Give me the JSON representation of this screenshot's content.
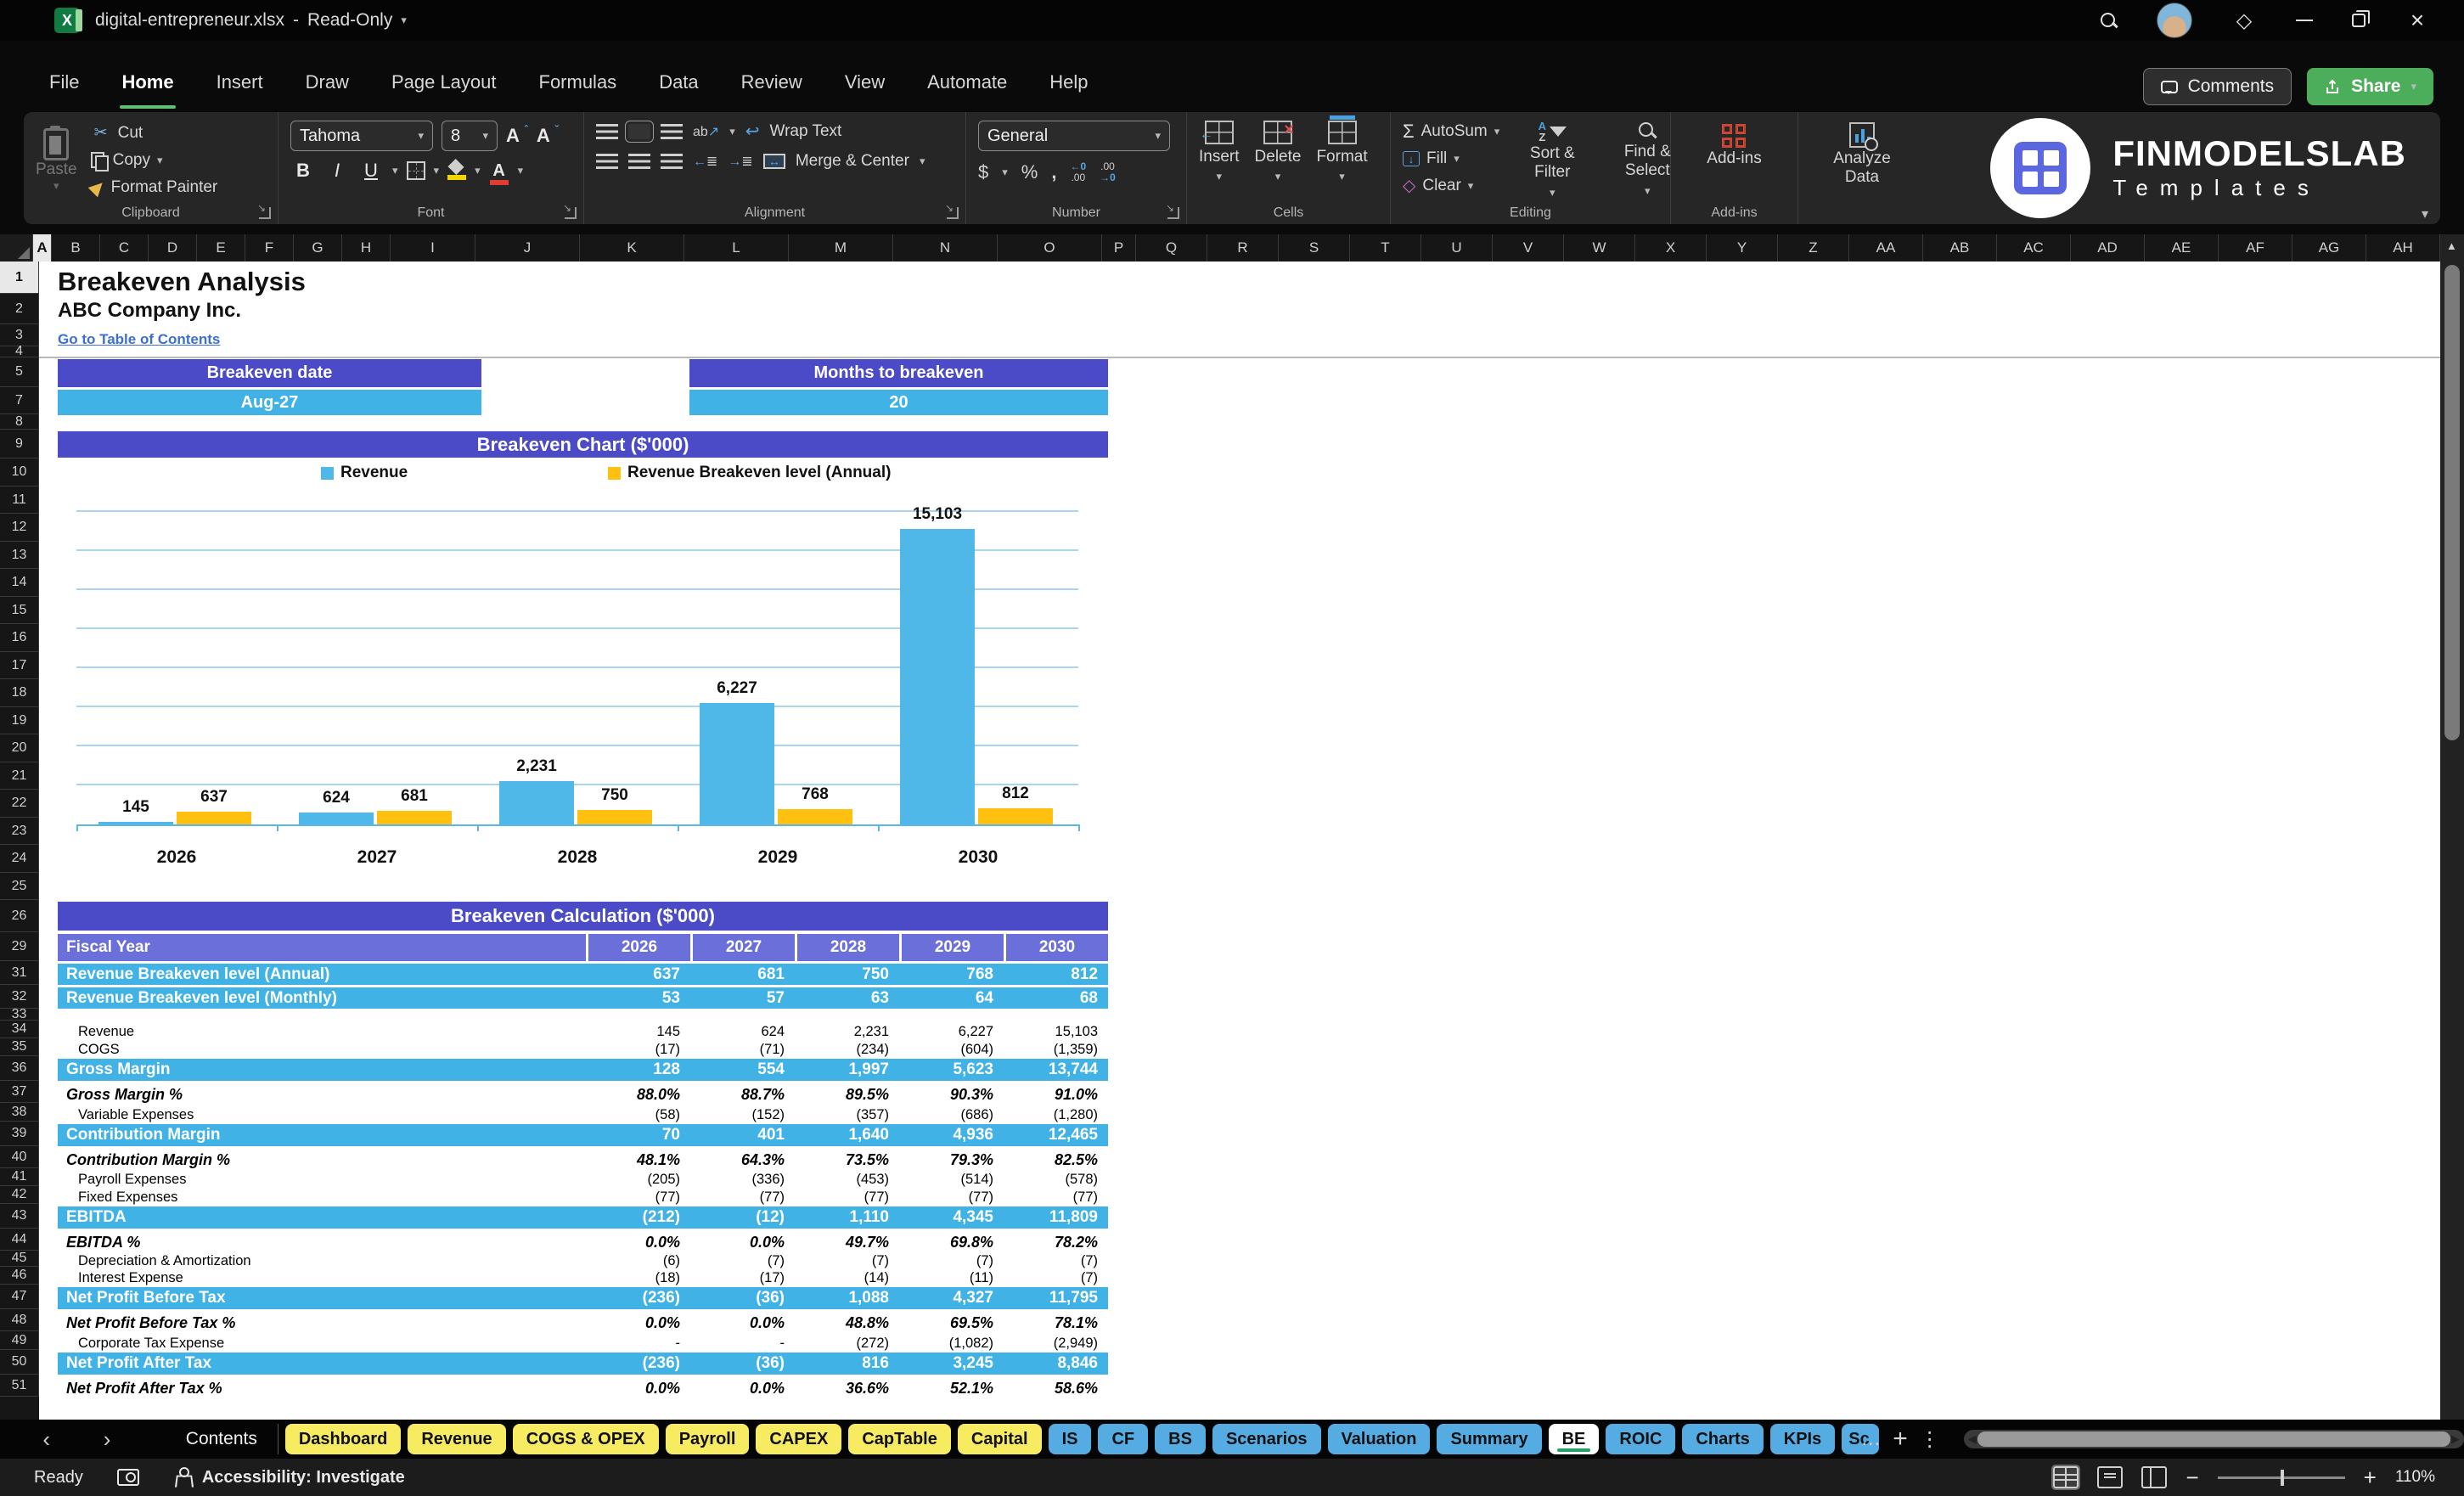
{
  "titlebar": {
    "filename": "digital-entrepreneur.xlsx",
    "separator": "-",
    "mode": "Read-Only"
  },
  "menubar": {
    "items": [
      "File",
      "Home",
      "Insert",
      "Draw",
      "Page Layout",
      "Formulas",
      "Data",
      "Review",
      "View",
      "Automate",
      "Help"
    ],
    "active": "Home",
    "comments_label": "Comments",
    "share_label": "Share"
  },
  "ribbon": {
    "clipboard": {
      "label": "Clipboard",
      "paste": "Paste",
      "cut": "Cut",
      "copy": "Copy",
      "format_painter": "Format Painter"
    },
    "font": {
      "label": "Font",
      "font_name": "Tahoma",
      "font_size": "8",
      "bold": "B",
      "italic": "I",
      "underline": "U"
    },
    "alignment": {
      "label": "Alignment",
      "wrap_text": "Wrap Text",
      "merge_center": "Merge & Center",
      "ab": "ab"
    },
    "number": {
      "label": "Number",
      "format": "General",
      "dollar": "$",
      "percent": "%",
      "comma": ","
    },
    "cells": {
      "label": "Cells",
      "insert": "Insert",
      "delete": "Delete",
      "format": "Format"
    },
    "editing": {
      "label": "Editing",
      "autosum": "AutoSum",
      "fill": "Fill",
      "clear": "Clear",
      "sort_filter": "Sort & Filter",
      "find_select": "Find & Select"
    },
    "addins": {
      "label": "Add-ins",
      "addins": "Add-ins",
      "analyze": "Analyze Data"
    },
    "logo": {
      "line1": "FINMODELSLAB",
      "line2": "Templates"
    }
  },
  "sheet": {
    "columns": [
      "A",
      "B",
      "C",
      "D",
      "E",
      "F",
      "G",
      "H",
      "I",
      "J",
      "K",
      "L",
      "M",
      "N",
      "O",
      "P",
      "Q",
      "R",
      "S",
      "T",
      "U",
      "V",
      "W",
      "X",
      "Y",
      "Z",
      "AA",
      "AB",
      "AC",
      "AD",
      "AE",
      "AF",
      "AG",
      "AH"
    ],
    "selected_column": "A",
    "row_numbers": [
      1,
      2,
      3,
      4,
      5,
      7,
      8,
      9,
      10,
      11,
      12,
      13,
      14,
      15,
      16,
      17,
      18,
      19,
      20,
      21,
      22,
      23,
      24,
      25,
      26,
      29,
      31,
      32,
      33,
      34,
      35,
      36,
      37,
      38,
      39,
      40,
      41,
      42,
      43,
      44,
      45,
      46,
      47,
      48,
      49,
      50,
      51
    ],
    "selected_row": 1,
    "title": "Breakeven Analysis",
    "subtitle": "ABC Company Inc.",
    "link": "Go to Table of Contents",
    "kpi": [
      {
        "label": "Breakeven date",
        "value": "Aug-27"
      },
      {
        "label": "Months to breakeven",
        "value": "20"
      }
    ]
  },
  "chart_data": {
    "type": "bar",
    "title": "Breakeven Chart ($'000)",
    "categories": [
      "2026",
      "2027",
      "2028",
      "2029",
      "2030"
    ],
    "series": [
      {
        "name": "Revenue",
        "color": "#4FB8E8",
        "values": [
          145,
          624,
          2231,
          6227,
          15103
        ],
        "labels": [
          "145",
          "624",
          "2,231",
          "6,227",
          "15,103"
        ]
      },
      {
        "name": "Revenue Breakeven level (Annual)",
        "color": "#FFC010",
        "values": [
          637,
          681,
          750,
          768,
          812
        ],
        "labels": [
          "637",
          "681",
          "750",
          "768",
          "812"
        ]
      }
    ],
    "ylim": [
      0,
      16500
    ],
    "gridline_step": 2000,
    "grid": true,
    "legend_position": "top",
    "data_labels": true,
    "xlabel": "",
    "ylabel": ""
  },
  "calc_table": {
    "title": "Breakeven Calculation ($'000)",
    "fiscal_label": "Fiscal Year",
    "years": [
      "2026",
      "2027",
      "2028",
      "2029",
      "2030"
    ],
    "rows": [
      {
        "label": "Revenue Breakeven level (Annual)",
        "type": "highlight",
        "values": [
          "637",
          "681",
          "750",
          "768",
          "812"
        ]
      },
      {
        "label": "Revenue Breakeven level (Monthly)",
        "type": "highlight",
        "values": [
          "53",
          "57",
          "63",
          "64",
          "68"
        ]
      },
      {
        "label": "",
        "type": "blank",
        "values": [
          "",
          "",
          "",
          "",
          ""
        ]
      },
      {
        "label": "Revenue",
        "type": "detail",
        "values": [
          "145",
          "624",
          "2,231",
          "6,227",
          "15,103"
        ]
      },
      {
        "label": "COGS",
        "type": "detail",
        "values": [
          "(17)",
          "(71)",
          "(234)",
          "(604)",
          "(1,359)"
        ]
      },
      {
        "label": "Gross Margin",
        "type": "highlight",
        "values": [
          "128",
          "554",
          "1,997",
          "5,623",
          "13,744"
        ]
      },
      {
        "label": "Gross Margin %",
        "type": "percent",
        "values": [
          "88.0%",
          "88.7%",
          "89.5%",
          "90.3%",
          "91.0%"
        ]
      },
      {
        "label": "Variable Expenses",
        "type": "detail",
        "values": [
          "(58)",
          "(152)",
          "(357)",
          "(686)",
          "(1,280)"
        ]
      },
      {
        "label": "Contribution Margin",
        "type": "highlight",
        "values": [
          "70",
          "401",
          "1,640",
          "4,936",
          "12,465"
        ]
      },
      {
        "label": "Contribution Margin %",
        "type": "percent",
        "values": [
          "48.1%",
          "64.3%",
          "73.5%",
          "79.3%",
          "82.5%"
        ]
      },
      {
        "label": "Payroll Expenses",
        "type": "detail",
        "values": [
          "(205)",
          "(336)",
          "(453)",
          "(514)",
          "(578)"
        ]
      },
      {
        "label": "Fixed Expenses",
        "type": "detail",
        "values": [
          "(77)",
          "(77)",
          "(77)",
          "(77)",
          "(77)"
        ]
      },
      {
        "label": "EBITDA",
        "type": "highlight",
        "values": [
          "(212)",
          "(12)",
          "1,110",
          "4,345",
          "11,809"
        ]
      },
      {
        "label": "EBITDA %",
        "type": "percent",
        "values": [
          "0.0%",
          "0.0%",
          "49.7%",
          "69.8%",
          "78.2%"
        ]
      },
      {
        "label": "Depreciation & Amortization",
        "type": "detail",
        "values": [
          "(6)",
          "(7)",
          "(7)",
          "(7)",
          "(7)"
        ]
      },
      {
        "label": "Interest Expense",
        "type": "detail",
        "values": [
          "(18)",
          "(17)",
          "(14)",
          "(11)",
          "(7)"
        ]
      },
      {
        "label": "Net Profit Before Tax",
        "type": "highlight",
        "values": [
          "(236)",
          "(36)",
          "1,088",
          "4,327",
          "11,795"
        ]
      },
      {
        "label": "Net Profit Before Tax %",
        "type": "percent",
        "values": [
          "0.0%",
          "0.0%",
          "48.8%",
          "69.5%",
          "78.1%"
        ]
      },
      {
        "label": "Corporate Tax Expense",
        "type": "detail",
        "values": [
          "-",
          "-",
          "(272)",
          "(1,082)",
          "(2,949)"
        ]
      },
      {
        "label": "Net Profit After Tax",
        "type": "highlight",
        "values": [
          "(236)",
          "(36)",
          "816",
          "3,245",
          "8,846"
        ]
      },
      {
        "label": "Net Profit After Tax %",
        "type": "percent",
        "values": [
          "0.0%",
          "0.0%",
          "36.6%",
          "52.1%",
          "58.6%"
        ]
      }
    ]
  },
  "tabs": {
    "nav_prev": "‹",
    "nav_next": "›",
    "sheets": [
      {
        "label": "Contents",
        "style": "plain"
      },
      {
        "label": "Dashboard",
        "style": "yellow"
      },
      {
        "label": "Revenue",
        "style": "yellow"
      },
      {
        "label": "COGS & OPEX",
        "style": "yellow"
      },
      {
        "label": "Payroll",
        "style": "yellow"
      },
      {
        "label": "CAPEX",
        "style": "yellow"
      },
      {
        "label": "CapTable",
        "style": "yellow"
      },
      {
        "label": "Capital",
        "style": "yellow"
      },
      {
        "label": "IS",
        "style": "blue"
      },
      {
        "label": "CF",
        "style": "blue"
      },
      {
        "label": "BS",
        "style": "blue"
      },
      {
        "label": "Scenarios",
        "style": "blue"
      },
      {
        "label": "Valuation",
        "style": "blue"
      },
      {
        "label": "Summary",
        "style": "blue"
      },
      {
        "label": "BE",
        "style": "active"
      },
      {
        "label": "ROIC",
        "style": "blue"
      },
      {
        "label": "Charts",
        "style": "blue"
      },
      {
        "label": "KPIs",
        "style": "blue"
      },
      {
        "label": "Sc",
        "style": "blue truncated"
      }
    ],
    "more": "…",
    "add_sheet": "+",
    "menu": "⋮"
  },
  "statusbar": {
    "ready": "Ready",
    "accessibility": "Accessibility: Investigate",
    "zoom": "110%"
  },
  "colors": {
    "banner_purple": "#4B4BC7",
    "fiscal_purple": "#6B6FD9",
    "sky_blue": "#41B2E5",
    "chart_blue": "#4FB8E8",
    "chart_yellow": "#FFC010",
    "tab_yellow": "#F6EB61",
    "tab_blue": "#55ACE3",
    "accent_green": "#4CAD5B",
    "link_blue": "#3B6FD4"
  }
}
